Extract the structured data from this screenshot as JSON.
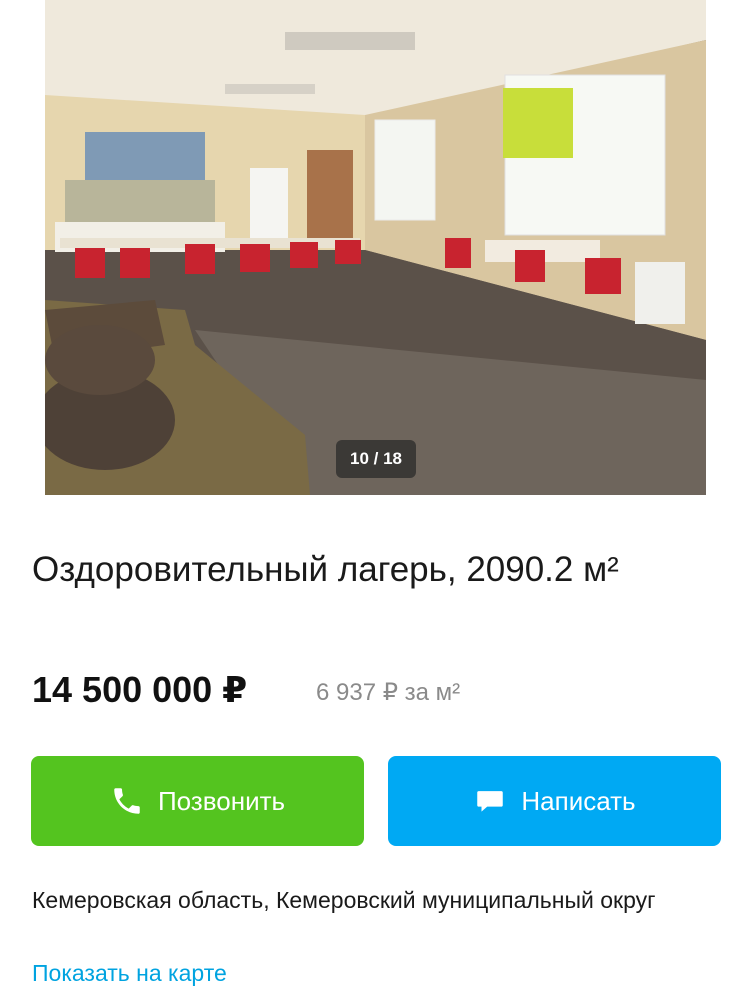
{
  "gallery": {
    "counter": "10 / 18",
    "photo_alt": "interior-dining-hall-photo"
  },
  "listing": {
    "title": "Оздоровительный лагерь, 2090.2 м²",
    "price": "14 500 000 ₽",
    "price_per_unit": "6 937 ₽ за м²"
  },
  "actions": {
    "call_label": "Позвонить",
    "call_icon": "phone-icon",
    "write_label": "Написать",
    "write_icon": "chat-bubble-icon"
  },
  "location": {
    "address": "Кемеровская область, Кемеровский муниципальный округ",
    "map_link": "Показать на карте"
  },
  "colors": {
    "call_button": "#54c41f",
    "write_button": "#00a9f3",
    "link": "#00a3e0",
    "muted_text": "#8a8a8a"
  }
}
